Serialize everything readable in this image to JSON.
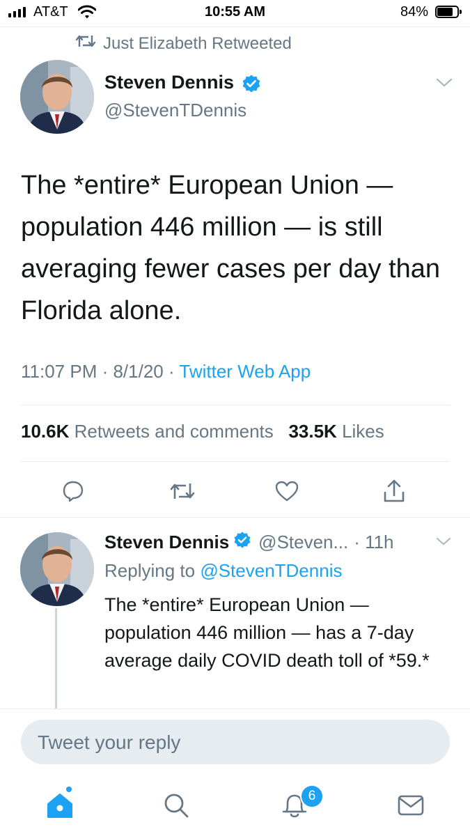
{
  "status_bar": {
    "carrier": "AT&T",
    "time": "10:55 AM",
    "battery_percent": "84%",
    "battery_level": 0.84
  },
  "retweet_context": {
    "label": "Just Elizabeth Retweeted"
  },
  "tweet": {
    "author_name": "Steven Dennis",
    "author_handle": "@StevenTDennis",
    "verified": true,
    "text": "The *entire* European Union — population 446 million — is still averaging fewer cases per day than Florida alone.",
    "timestamp": "11:07 PM · 8/1/20 · ",
    "source": "Twitter Web App",
    "retweets_count": "10.6K",
    "retweets_label": "Retweets and comments",
    "likes_count": "33.5K",
    "likes_label": "Likes"
  },
  "reply": {
    "author_name": "Steven Dennis",
    "author_handle": "@Steven...",
    "age": "· 11h",
    "replying_prefix": "Replying to ",
    "replying_handle": "@StevenTDennis",
    "text": "The *entire* European Union — population 446 million — has a 7-day average daily COVID death toll of *59.*"
  },
  "composer": {
    "placeholder": "Tweet your reply"
  },
  "tab_bar": {
    "notifications_badge": "6"
  },
  "colors": {
    "accent": "#1da1f2",
    "text": "#14171a",
    "secondary_text": "#657786",
    "divider": "#e6ecf0"
  },
  "icons": [
    "wifi-icon",
    "battery-icon",
    "retweet-icon",
    "verified-icon",
    "chevron-down-icon",
    "reply-icon",
    "like-icon",
    "share-icon",
    "home-icon",
    "search-icon",
    "notifications-icon",
    "messages-icon"
  ]
}
